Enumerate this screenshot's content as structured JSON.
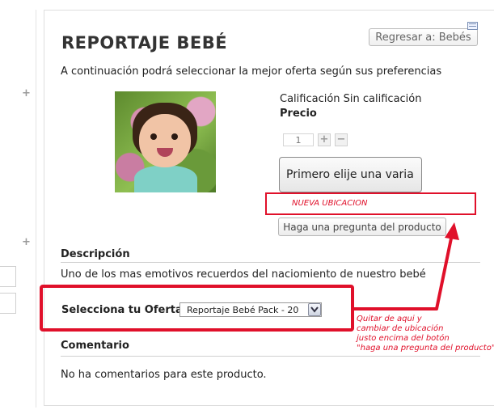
{
  "page": {
    "title": "REPORTAJE BEBÉ",
    "back_button": "Regresar a: Bebés",
    "intro": "A continuación podrá seleccionar la mejor oferta según sus preferencias"
  },
  "product": {
    "rating": "Calificación Sin calificación",
    "price_label": "Precio",
    "quantity": "1",
    "choose_button": "Primero elije una varia",
    "question_button": "Haga una pregunta del producto"
  },
  "annotations": {
    "new_location": "NUEVA UBICACION",
    "note_lines": [
      "Quitar de aqui y",
      "cambiar de ubicación",
      "justo encima del botón",
      "\"haga una pregunta del producto\""
    ],
    "accent_color": "#e0102a"
  },
  "description": {
    "heading": "Descripción",
    "text": "Uno de los mas emotivos recuerdos del naciomiento de nuestro bebé"
  },
  "offer": {
    "label": "Selecciona tu Oferta",
    "selected": "Reportaje Bebé Pack - 20"
  },
  "comments": {
    "heading": "Comentario",
    "empty_text": "No ha comentarios para este producto."
  },
  "icons": {
    "plus": "+",
    "minus": "−",
    "mail": "mail-icon",
    "dropdown": "chevron-down-icon"
  }
}
